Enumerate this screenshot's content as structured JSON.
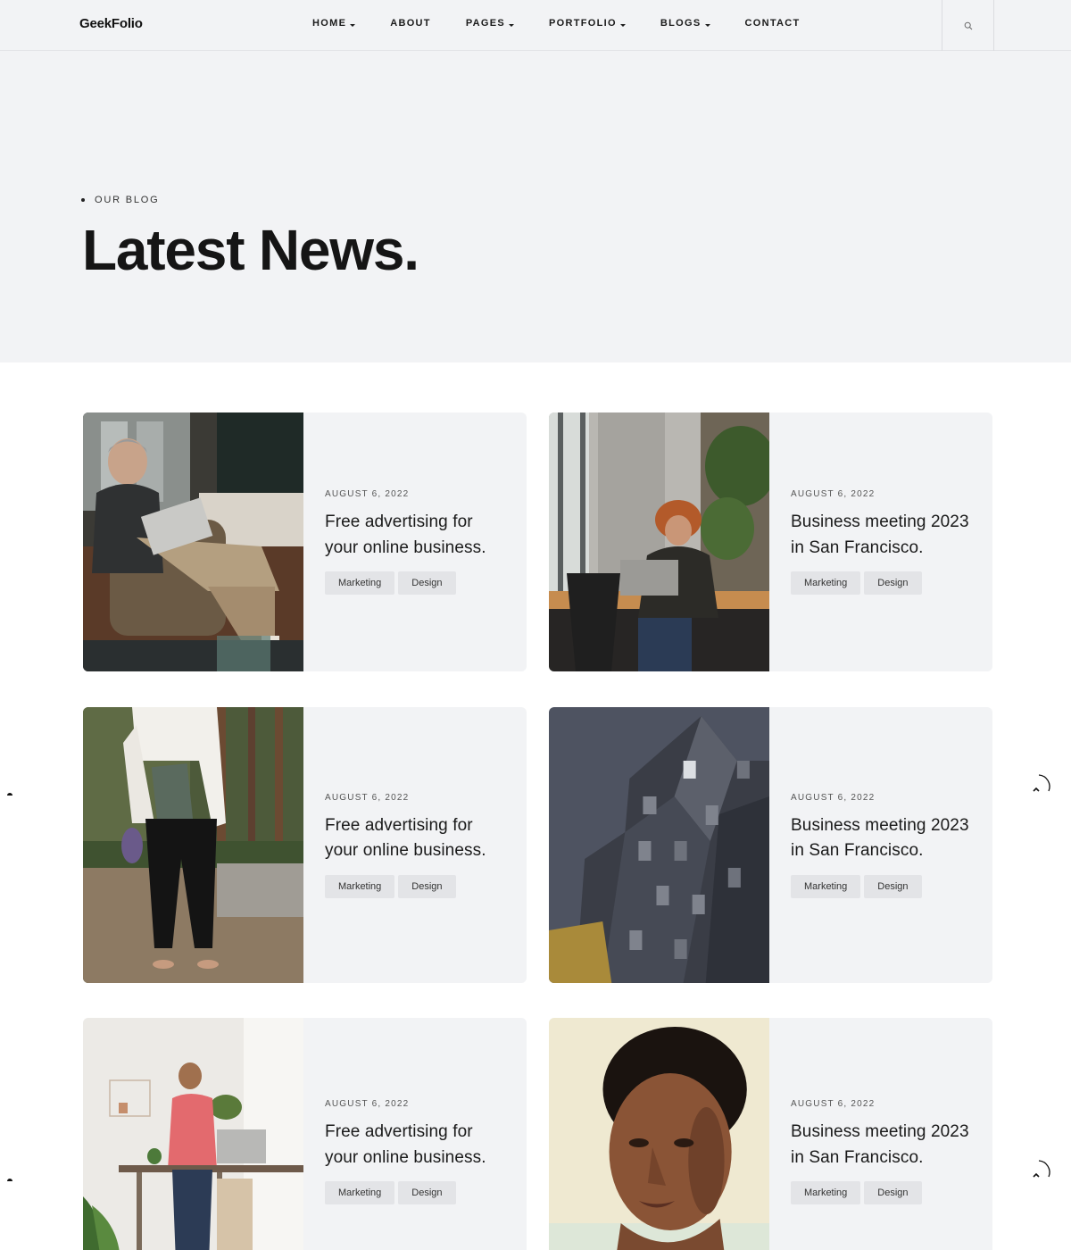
{
  "header": {
    "logo": "GeekFolio",
    "nav": [
      {
        "label": "HOME",
        "dropdown": true
      },
      {
        "label": "ABOUT",
        "dropdown": false
      },
      {
        "label": "PAGES",
        "dropdown": true
      },
      {
        "label": "PORTFOLIO",
        "dropdown": true
      },
      {
        "label": "BLOGS",
        "dropdown": true
      },
      {
        "label": "CONTACT",
        "dropdown": false
      }
    ],
    "search_icon": "search-icon"
  },
  "hero": {
    "eyebrow": "OUR BLOG",
    "title": "Latest News."
  },
  "posts": [
    {
      "date": "AUGUST 6, 2022",
      "title": "Free advertising for your online business.",
      "tags": [
        "Marketing",
        "Design"
      ],
      "image": "man-with-laptop-on-sofa"
    },
    {
      "date": "AUGUST 6, 2022",
      "title": "Business meeting 2023 in San Francisco.",
      "tags": [
        "Marketing",
        "Design"
      ],
      "image": "person-working-at-desk"
    },
    {
      "date": "AUGUST 6, 2022",
      "title": "Free advertising for your online business.",
      "tags": [
        "Marketing",
        "Design"
      ],
      "image": "woman-holding-magazine-in-forest"
    },
    {
      "date": "AUGUST 6, 2022",
      "title": "Business meeting 2023 in San Francisco.",
      "tags": [
        "Marketing",
        "Design"
      ],
      "image": "modern-building"
    },
    {
      "date": "AUGUST 6, 2022",
      "title": "Free advertising for your online business.",
      "tags": [
        "Marketing",
        "Design"
      ],
      "image": "man-on-phone-at-standing-desk"
    },
    {
      "date": "AUGUST 6, 2022",
      "title": "Business meeting 2023 in San Francisco.",
      "tags": [
        "Marketing",
        "Design"
      ],
      "image": "portrait-of-man"
    }
  ],
  "colors": {
    "hero_bg": "#f2f3f5",
    "card_bg": "#f2f3f5",
    "tag_bg": "#e3e4e7",
    "text": "#1a1a1a"
  }
}
